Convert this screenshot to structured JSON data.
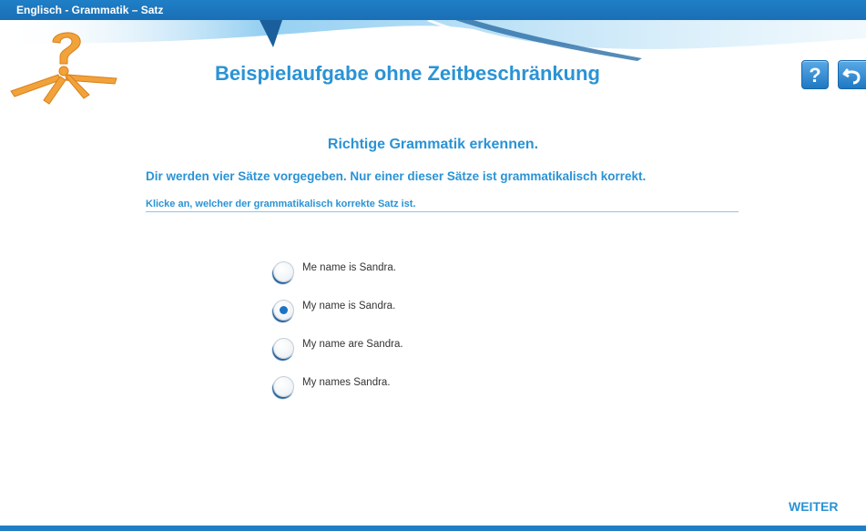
{
  "topbar": {
    "title": "Englisch - Grammatik – Satz"
  },
  "header": {
    "title": "Beispielaufgabe ohne Zeitbeschränkung",
    "help_label": "?",
    "logo_icon": "question-arrows-logo",
    "back_icon": "undo-arrow-icon"
  },
  "task": {
    "heading": "Richtige Grammatik erkennen.",
    "description": "Dir werden vier Sätze vorgegeben. Nur einer dieser Sätze ist grammatikalisch korrekt.",
    "hint": "Klicke an, welcher der grammatikalisch korrekte Satz ist."
  },
  "options": [
    {
      "label": "Me name is Sandra.",
      "selected": false
    },
    {
      "label": "My name is Sandra.",
      "selected": true
    },
    {
      "label": "My name are Sandra.",
      "selected": false
    },
    {
      "label": "My names Sandra.",
      "selected": false
    }
  ],
  "footer": {
    "next_label": "WEITER"
  },
  "colors": {
    "accent": "#2a93d5",
    "bar": "#1f7fc6",
    "logo": "#f2a23a"
  }
}
